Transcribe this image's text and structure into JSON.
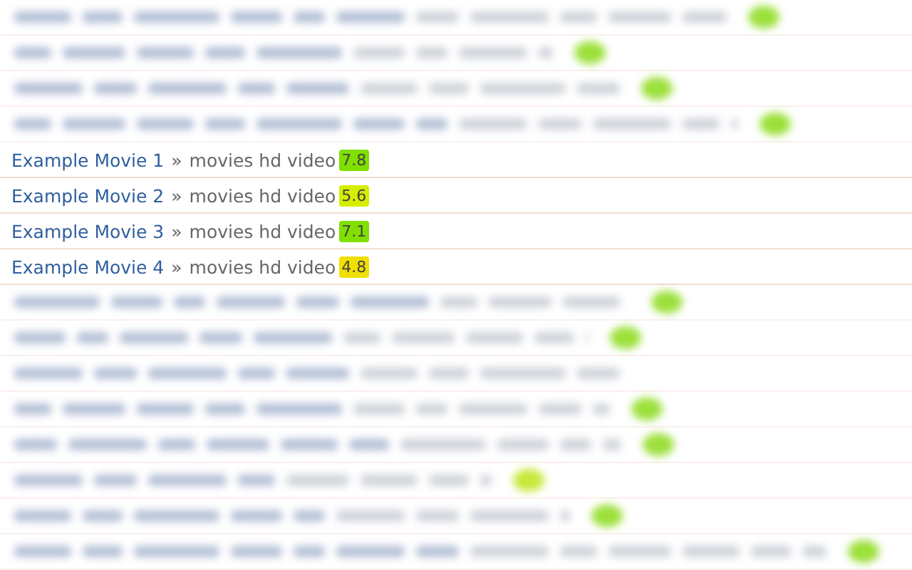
{
  "blurred_rows_top": [
    {
      "kind": "rated",
      "color": "#9be03a"
    },
    {
      "kind": "rated",
      "color": "#9be03a"
    },
    {
      "kind": "rated",
      "color": "#9be03a"
    },
    {
      "kind": "rated",
      "color": "#9be03a"
    }
  ],
  "movies": [
    {
      "title": "Example Movie 1",
      "separator": "»",
      "category": "movies hd video",
      "rating": "7.8",
      "color": "#7fe000"
    },
    {
      "title": "Example Movie 2",
      "separator": "»",
      "category": "movies hd video",
      "rating": "5.6",
      "color": "#d6ee00"
    },
    {
      "title": "Example Movie 3",
      "separator": "»",
      "category": "movies hd video",
      "rating": "7.1",
      "color": "#7fe000"
    },
    {
      "title": "Example Movie 4",
      "separator": "»",
      "category": "movies hd video",
      "rating": "4.8",
      "color": "#f0e000"
    }
  ],
  "blurred_rows_bottom": [
    {
      "kind": "rated",
      "color": "#9be03a"
    },
    {
      "kind": "rated",
      "color": "#9be03a"
    },
    {
      "kind": "plain"
    },
    {
      "kind": "rated",
      "color": "#9be03a"
    },
    {
      "kind": "rated",
      "color": "#9be03a"
    },
    {
      "kind": "rated",
      "color": "#c8e83a"
    },
    {
      "kind": "rated",
      "color": "#9be03a"
    },
    {
      "kind": "rated",
      "color": "#9be03a"
    }
  ]
}
